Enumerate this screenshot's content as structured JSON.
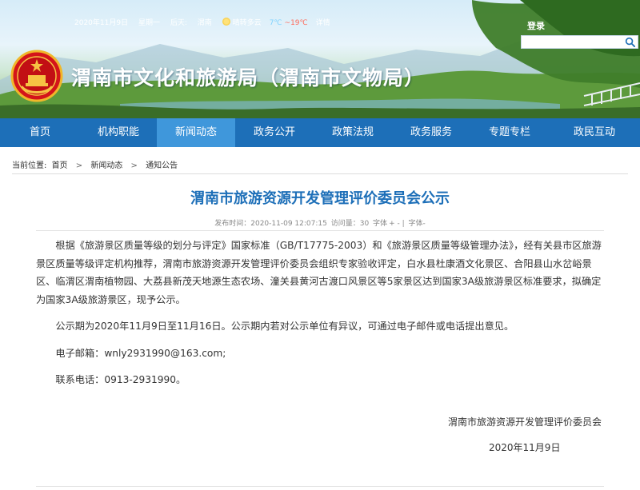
{
  "topbar": {
    "date": "2020年11月9日",
    "weekday": "星期一",
    "weather_label": "后天:",
    "city": "渭南",
    "condition": "晴转多云",
    "temp_low": "7℃",
    "temp_high": "~19℃",
    "detail_link": "详情",
    "login": "登录"
  },
  "search": {
    "placeholder": ""
  },
  "site": {
    "title": "渭南市文化和旅游局（渭南市文物局）"
  },
  "nav": {
    "items": [
      "首页",
      "机构职能",
      "新闻动态",
      "政务公开",
      "政策法规",
      "政务服务",
      "专题专栏",
      "政民互动"
    ],
    "active": "新闻动态"
  },
  "breadcrumb": {
    "label": "当前位置:",
    "items": [
      "首页",
      "新闻动态",
      "通知公告"
    ],
    "separator": ">"
  },
  "article": {
    "title": "渭南市旅游资源开发管理评价委员会公示",
    "meta": {
      "published": "发布时间：2020-11-09 12:07:15",
      "views": "访问量：30",
      "font_label": "字体",
      "font_size_options": "+ - |",
      "font_label2": "字体-"
    },
    "paragraphs": [
      "根据《旅游景区质量等级的划分与评定》国家标准（GB/T17775-2003）和《旅游景区质量等级管理办法》，经有关县市区旅游景区质量等级评定机构推荐，渭南市旅游资源开发管理评价委员会组织专家验收评定，白水县杜康酒文化景区、合阳县山水岔峪景区、临渭区渭南植物园、大荔县新茂天地源生态农场、潼关县黄河古渡口风景区等5家景区达到国家3A级旅游景区标准要求，拟确定为国家3A级旅游景区，现予公示。",
      "公示期为2020年11月9日至11月16日。公示期内若对公示单位有异议，可通过电子邮件或电话提出意见。",
      "电子邮箱：wnly2931990@163.com;",
      "联系电话：0913-2931990。"
    ],
    "signature": "渭南市旅游资源开发管理评价委员会",
    "date": "2020年11月9日"
  },
  "colors": {
    "nav_bg": "#1d6fb8",
    "nav_active": "#3f97db",
    "title_blue": "#1d6fb8"
  },
  "icons": [
    "search-icon",
    "national-emblem-icon",
    "weather-sun-icon"
  ]
}
